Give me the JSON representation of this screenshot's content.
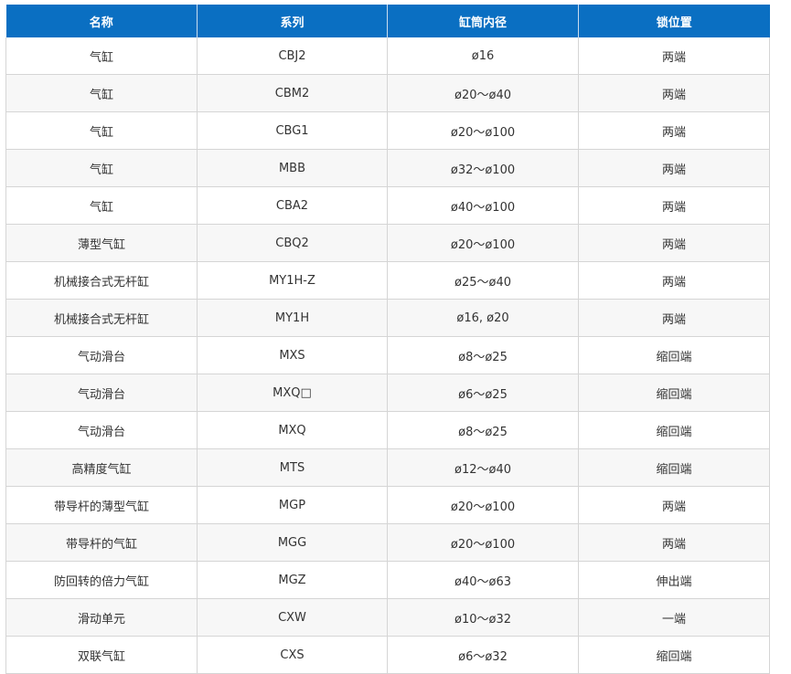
{
  "table": {
    "headers": [
      "名称",
      "系列",
      "缸筒内径",
      "锁位置"
    ],
    "rows": [
      [
        "气缸",
        "CBJ2",
        "ø16",
        "两端"
      ],
      [
        "气缸",
        "CBM2",
        "ø20～ø40",
        "两端"
      ],
      [
        "气缸",
        "CBG1",
        "ø20～ø100",
        "两端"
      ],
      [
        "气缸",
        "MBB",
        "ø32～ø100",
        "两端"
      ],
      [
        "气缸",
        "CBA2",
        "ø40～ø100",
        "两端"
      ],
      [
        "薄型气缸",
        "CBQ2",
        "ø20～ø100",
        "两端"
      ],
      [
        "机械接合式无杆缸",
        "MY1H-Z",
        "ø25～ø40",
        "两端"
      ],
      [
        "机械接合式无杆缸",
        "MY1H",
        "ø16, ø20",
        "两端"
      ],
      [
        "气动滑台",
        "MXS",
        "ø8～ø25",
        "缩回端"
      ],
      [
        "气动滑台",
        "MXQ□",
        "ø6～ø25",
        "缩回端"
      ],
      [
        "气动滑台",
        "MXQ",
        "ø8～ø25",
        "缩回端"
      ],
      [
        "高精度气缸",
        "MTS",
        "ø12～ø40",
        "缩回端"
      ],
      [
        "带导杆的薄型气缸",
        "MGP",
        "ø20～ø100",
        "两端"
      ],
      [
        "带导杆的气缸",
        "MGG",
        "ø20～ø100",
        "两端"
      ],
      [
        "防回转的倍力气缸",
        "MGZ",
        "ø40～ø63",
        "伸出端"
      ],
      [
        "滑动单元",
        "CXW",
        "ø10～ø32",
        "一端"
      ],
      [
        "双联气缸",
        "CXS",
        "ø6～ø32",
        "缩回端"
      ]
    ]
  },
  "colors": {
    "header_bg": "#0a6fc2",
    "header_text": "#ffffff",
    "stripe_bg": "#f7f7f7",
    "grid_line": "#d5d5d5"
  }
}
